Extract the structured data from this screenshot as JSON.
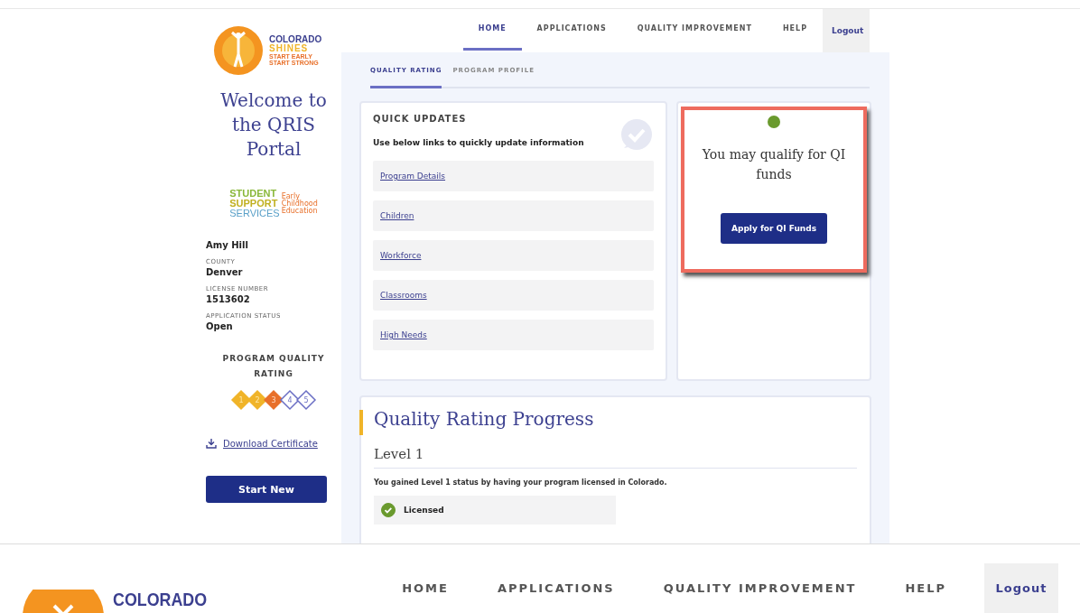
{
  "top": {
    "logo": {
      "lines": [
        "COLORADO",
        "SHINES",
        "START EARLY",
        "START STRONG"
      ]
    },
    "nav": [
      {
        "label": "HOME",
        "selected": true
      },
      {
        "label": "APPLICATIONS",
        "selected": false
      },
      {
        "label": "QUALITY IMPROVEMENT",
        "selected": false
      },
      {
        "label": "HELP",
        "selected": false
      }
    ],
    "logout": "Logout",
    "sidebar": {
      "welcome": "Welcome to the QRIS Portal",
      "partner_logo": {
        "words": [
          "STUDENT",
          "SUPPORT",
          "SERVICES"
        ],
        "side": [
          "Early",
          "Childhood",
          "Education"
        ]
      },
      "name": "Amy Hill",
      "fields": [
        {
          "label": "COUNTY",
          "value": "Denver"
        },
        {
          "label": "LICENSE NUMBER",
          "value": "1513602"
        },
        {
          "label": "APPLICATION STATUS",
          "value": "Open"
        }
      ],
      "rating_title": "PROGRAM QUALITY RATING",
      "rating": [
        {
          "label": "1",
          "kind": "achieved"
        },
        {
          "label": "2",
          "kind": "achieved"
        },
        {
          "label": "3",
          "kind": "current"
        },
        {
          "label": "4",
          "kind": "pending"
        },
        {
          "label": "5",
          "kind": "pending"
        }
      ],
      "download": "Download Certificate",
      "start_button": "Start New"
    },
    "subtabs": [
      {
        "label": "QUALITY RATING",
        "selected": true
      },
      {
        "label": "PROGRAM PROFILE",
        "selected": false
      }
    ],
    "quick_updates": {
      "title": "QUICK UPDATES",
      "subtitle": "Use below links to quickly update information",
      "links": [
        "Program Details",
        "Children",
        "Workforce",
        "Classrooms",
        "High Needs"
      ]
    },
    "qi_card": {
      "message": "You may qualify for QI funds",
      "button": "Apply for QI Funds",
      "highlighted": true
    },
    "progress": {
      "title": "Quality Rating Progress",
      "level": "Level 1",
      "description": "You gained Level 1 status by having your program licensed in Colorado.",
      "items": [
        {
          "label": "Licensed",
          "done": true
        }
      ]
    }
  },
  "bottom": {
    "logo_text": "COLORADO",
    "nav": [
      {
        "label": "HOME",
        "selected": false
      },
      {
        "label": "APPLICATIONS",
        "selected": false
      },
      {
        "label": "QUALITY IMPROVEMENT",
        "selected": false
      },
      {
        "label": "HELP",
        "selected": false
      }
    ],
    "logout": "Logout"
  }
}
